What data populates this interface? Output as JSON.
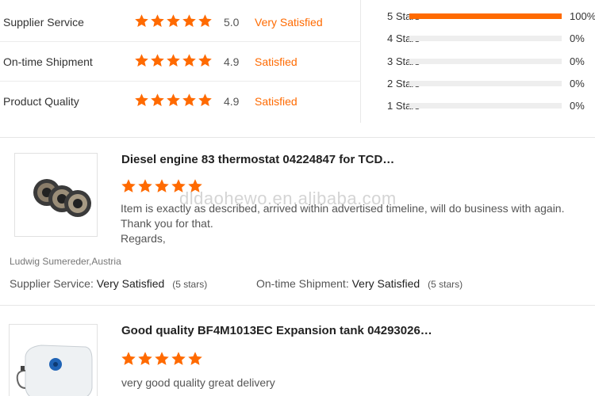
{
  "metrics": [
    {
      "label": "Supplier Service",
      "score": "5.0",
      "verdict": "Very Satisfied"
    },
    {
      "label": "On-time Shipment",
      "score": "4.9",
      "verdict": "Satisfied"
    },
    {
      "label": "Product Quality",
      "score": "4.9",
      "verdict": "Satisfied"
    }
  ],
  "distribution": [
    {
      "label": "5  Stars",
      "percent": "100%",
      "fill": 1.0
    },
    {
      "label": "4  Stars",
      "percent": "0%",
      "fill": 0.0
    },
    {
      "label": "3  Stars",
      "percent": "0%",
      "fill": 0.0
    },
    {
      "label": "2  Stars",
      "percent": "0%",
      "fill": 0.0
    },
    {
      "label": "1  Stars",
      "percent": "0%",
      "fill": 0.0
    }
  ],
  "reviews": [
    {
      "title": "Diesel engine 83 thermostat 04224847 for TCD…",
      "rating": 5,
      "text_lines": [
        "Item is exactly as described, arrived within advertised timeline, will do business with again.",
        "Thank you for that.",
        "Regards,"
      ],
      "reviewer": "Ludwig Sumereder,Austria",
      "supplier_label": "Supplier Service:",
      "supplier_value": "Very Satisfied",
      "supplier_stars": "(5 stars)",
      "shipment_label": "On-time Shipment:",
      "shipment_value": "Very Satisfied",
      "shipment_stars": "(5 stars)"
    },
    {
      "title": "Good quality BF4M1013EC Expansion tank 04293026…",
      "rating": 5,
      "text_lines": [
        "very good quality great delivery"
      ]
    }
  ],
  "watermark": "dldaohewo.en.alibaba.com",
  "colors": {
    "accent": "#ff6a00",
    "track": "#eeeeee"
  }
}
